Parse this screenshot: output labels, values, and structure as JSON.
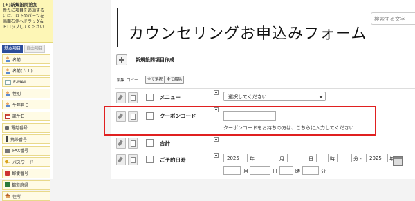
{
  "sidebar": {
    "header_title": "[+]新規設問追加",
    "header_desc_lines": [
      "新たに項目を追加する",
      "には、以下のパーツを",
      "画面右側へドラッグ&",
      "ドロップしてください"
    ],
    "tabs": [
      {
        "label": "基本項目",
        "active": true
      },
      {
        "label": "自由項目",
        "active": false
      }
    ],
    "items": [
      {
        "label": "名前",
        "icon": "person-icon"
      },
      {
        "label": "名前(カナ)",
        "icon": "person-icon"
      },
      {
        "label": "E-MAIL",
        "icon": "mail-icon"
      },
      {
        "label": "性別",
        "icon": "person-icon"
      },
      {
        "label": "生年月日",
        "icon": "person-icon"
      },
      {
        "label": "誕生日",
        "icon": "calendar-icon"
      },
      {
        "label": "電話番号",
        "icon": "phone-icon"
      },
      {
        "label": "携帯番号",
        "icon": "mobile-icon"
      },
      {
        "label": "FAX番号",
        "icon": "fax-icon"
      },
      {
        "label": "パスワード",
        "icon": "key-icon"
      },
      {
        "label": "郵便番号",
        "icon": "postal-icon"
      },
      {
        "label": "都道府県",
        "icon": "prefecture-icon"
      },
      {
        "label": "住所",
        "icon": "house-icon"
      }
    ]
  },
  "form": {
    "title": "カウンセリングお申込みフォーム",
    "search_placeholder": "検索する文字",
    "section_label": "新規設問項目作成",
    "col_edit": "編集",
    "col_copy": "コピー",
    "select_all": "全て選択",
    "deselect_all": "全て解除",
    "rows": {
      "menu": {
        "label": "メニュー",
        "select_value": "選択してください"
      },
      "coupon": {
        "label": "クーポンコード",
        "input_value": "",
        "help": "クーポンコードをお持ちの方は、こちらに入力してください"
      },
      "total": {
        "label": "合計"
      },
      "datetime": {
        "label": "ご予約日時",
        "line1": {
          "year": "2025",
          "y_unit": "年",
          "m_unit": "月",
          "d_unit": "日",
          "h_unit": "時",
          "mi_unit": "分 -",
          "year2": "2025",
          "y2_unit": "年"
        },
        "line2": {
          "m_unit": "月",
          "d_unit": "日",
          "h_unit": "時",
          "mi_unit": "分"
        }
      }
    }
  },
  "colors": {
    "highlight": "#e02020",
    "sidebar_header": "#fdf6b6",
    "active_tab": "#2d4d9a"
  }
}
